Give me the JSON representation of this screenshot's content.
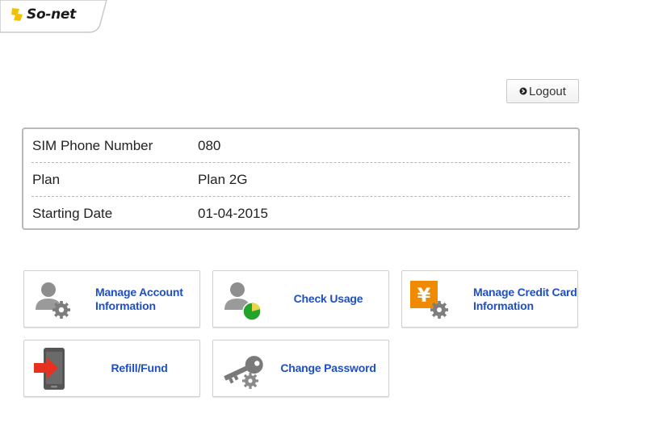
{
  "brand": {
    "logo_text": "So-net",
    "logo_icon": "so-net-logo-icon"
  },
  "header": {
    "logout_label": "Logout",
    "logout_icon": "arrow-circle-icon"
  },
  "account_info": {
    "rows": [
      {
        "label": "SIM Phone Number",
        "value": "080"
      },
      {
        "label": "Plan",
        "value": "Plan 2G"
      },
      {
        "label": "Starting Date",
        "value": "01-04-2015"
      }
    ]
  },
  "menu": {
    "manage_account": {
      "label": "Manage Account Information",
      "icon": "user-gear-icon"
    },
    "check_usage": {
      "label": "Check Usage",
      "icon": "user-pie-chart-icon"
    },
    "manage_credit_card": {
      "label": "Manage Credit Card Information",
      "icon": "yen-gear-icon"
    },
    "refill": {
      "label": "Refill/Fund",
      "icon": "phone-arrow-icon"
    },
    "change_password": {
      "label": "Change Password",
      "icon": "key-gear-icon"
    }
  },
  "colors": {
    "accent_text": "#1f4fc2",
    "logo_yellow": "#f2c200",
    "usage_green": "#22a32a",
    "yen_orange": "#f08a00",
    "arrow_red": "#e83020"
  }
}
